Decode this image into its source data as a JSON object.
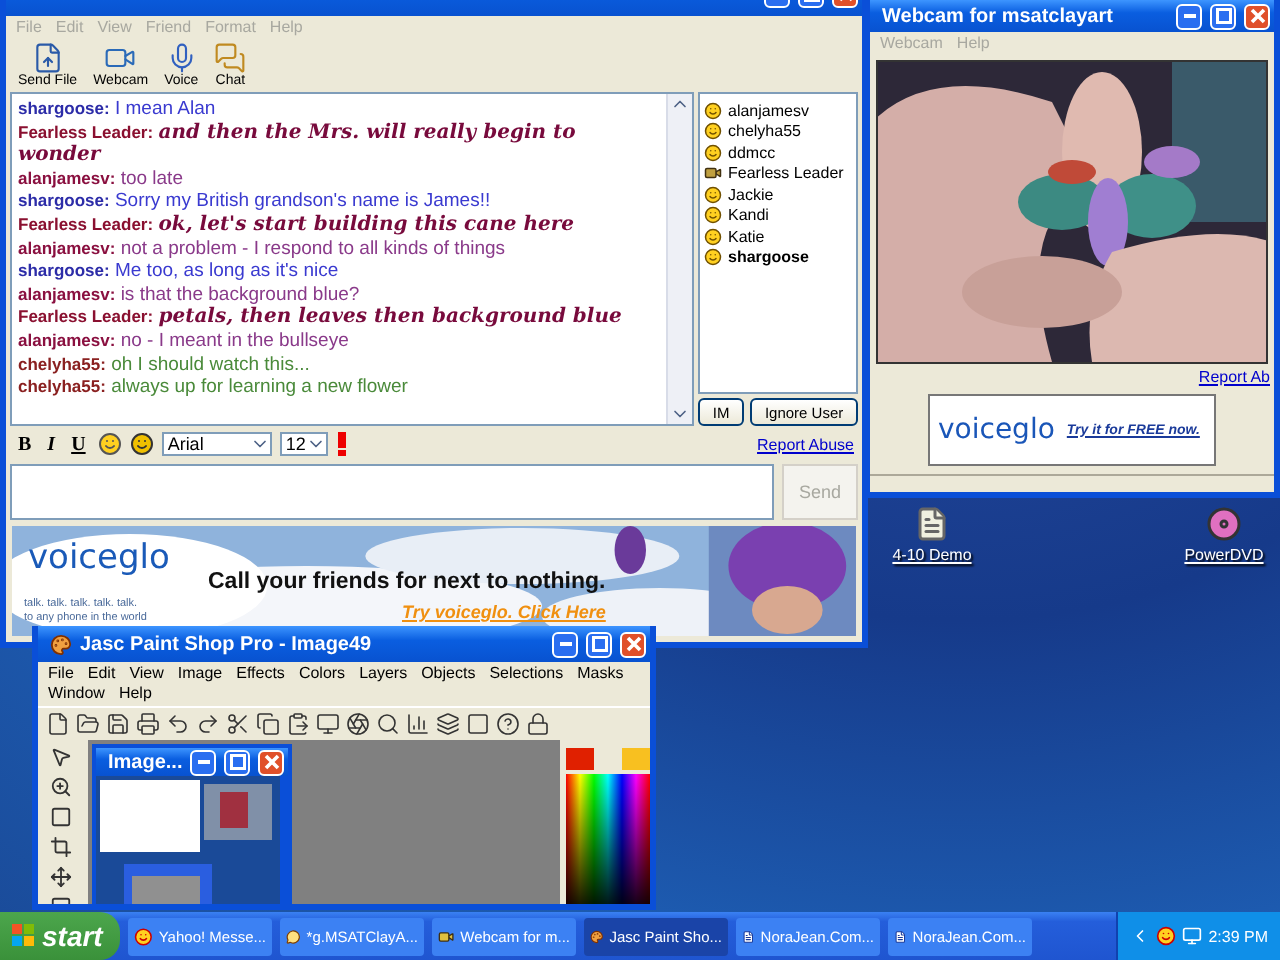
{
  "chat_window": {
    "menu": [
      "File",
      "Edit",
      "View",
      "Friend",
      "Format",
      "Help"
    ],
    "toolbar": [
      {
        "label": "Send File",
        "kind": "file"
      },
      {
        "label": "Webcam",
        "kind": "webcam"
      },
      {
        "label": "Voice",
        "kind": "voice"
      },
      {
        "label": "Chat",
        "kind": "chat"
      }
    ],
    "messages": [
      {
        "sender": {
          "name": "shargoose:",
          "color": "#2c2ca8"
        },
        "text": "I mean Alan",
        "kind": "plain",
        "color": "#3a3ad0"
      },
      {
        "sender": {
          "name": "Fearless Leader:",
          "color": "#8a1030"
        },
        "text": "and then the Mrs. will really begin to wonder",
        "kind": "script",
        "color": "#780a3c"
      },
      {
        "sender": {
          "name": "alanjamesv:",
          "color": "#8a1040"
        },
        "text": "too late",
        "kind": "plain",
        "color": "#8a3a8a"
      },
      {
        "sender": {
          "name": "shargoose:",
          "color": "#2c2ca8"
        },
        "text": "Sorry my British grandson's name is James!!",
        "kind": "plain",
        "color": "#3a3ad0"
      },
      {
        "sender": {
          "name": "Fearless Leader:",
          "color": "#8a1030"
        },
        "text": "ok, let's start building this cane here",
        "kind": "script",
        "color": "#780a3c"
      },
      {
        "sender": {
          "name": "alanjamesv:",
          "color": "#8a1040"
        },
        "text": "not a problem - I respond to all kinds of things",
        "kind": "plain",
        "color": "#8a3a8a"
      },
      {
        "sender": {
          "name": "shargoose:",
          "color": "#2c2ca8"
        },
        "text": "Me too, as long as it's nice",
        "kind": "plain",
        "color": "#3a3ad0"
      },
      {
        "sender": {
          "name": "alanjamesv:",
          "color": "#8a1040"
        },
        "text": "is that the background blue?",
        "kind": "plain",
        "color": "#8a3a8a"
      },
      {
        "sender": {
          "name": "Fearless Leader:",
          "color": "#8a1030"
        },
        "text": "petals, then leaves then background blue",
        "kind": "script",
        "color": "#780a3c"
      },
      {
        "sender": {
          "name": "alanjamesv:",
          "color": "#8a1040"
        },
        "text": "no - I meant in the bullseye",
        "kind": "plain",
        "color": "#8a3a8a"
      },
      {
        "sender": {
          "name": "chelyha55:",
          "color": "#8a2020"
        },
        "text": "oh I should watch this...",
        "kind": "plain",
        "color": "#4a8a3a"
      },
      {
        "sender": {
          "name": "chelyha55:",
          "color": "#8a2020"
        },
        "text": "always up for learning a new flower",
        "kind": "plain",
        "color": "#4a8a3a"
      }
    ],
    "users": [
      {
        "name": "alanjamesv",
        "kind": "smiley",
        "selected": false
      },
      {
        "name": "chelyha55",
        "kind": "smiley",
        "selected": false
      },
      {
        "name": "ddmcc",
        "kind": "smiley",
        "selected": false
      },
      {
        "name": "Fearless Leader",
        "kind": "webcam",
        "selected": false
      },
      {
        "name": "Jackie",
        "kind": "smiley",
        "selected": false
      },
      {
        "name": "Kandi",
        "kind": "smiley",
        "selected": false
      },
      {
        "name": "Katie",
        "kind": "smiley",
        "selected": false
      },
      {
        "name": "shargoose",
        "kind": "smiley",
        "selected": true
      }
    ],
    "user_buttons": [
      "IM",
      "Ignore User"
    ],
    "format_bar": {
      "bold": "B",
      "italic": "I",
      "underline": "U",
      "font": "Arial",
      "size": "12",
      "link": "Report Abuse"
    },
    "send_button": {
      "label": "Send",
      "disabled": true
    },
    "ad": {
      "brand": "voiceglo",
      "tagline": "talk. talk. talk. talk. talk.",
      "tagline_2": "to any phone in the world",
      "headline": "Call your friends for next to nothing.",
      "link": "Try voiceglo. Click Here"
    }
  },
  "webcam_window": {
    "title": "Webcam for msatclayart",
    "menu": [
      "Webcam",
      "Help"
    ],
    "link": "Report Ab",
    "ad": {
      "brand": "voiceglo",
      "link": "Try it for FREE now."
    }
  },
  "desktop_icons": [
    {
      "label": "4-10 Demo",
      "kind": "document"
    },
    {
      "label": "PowerDVD",
      "kind": "disc"
    }
  ],
  "paint_window": {
    "title": "Jasc Paint Shop Pro - Image49",
    "menu": [
      "File",
      "Edit",
      "View",
      "Image",
      "Effects",
      "Colors",
      "Layers",
      "Objects",
      "Selections",
      "Masks",
      "Window",
      "Help"
    ],
    "image_window": {
      "title": "Image..."
    }
  },
  "taskbar": {
    "start": "start",
    "items": [
      {
        "label": "Yahoo! Messe...",
        "kind": "messenger",
        "selected": false
      },
      {
        "label": "*g.MSATClayA...",
        "kind": "chat",
        "selected": false
      },
      {
        "label": "Webcam for m...",
        "kind": "webcam",
        "selected": false
      },
      {
        "label": "Jasc Paint Sho...",
        "kind": "paint",
        "selected": true
      },
      {
        "label": "NoraJean.Com...",
        "kind": "document",
        "selected": false
      },
      {
        "label": "NoraJean.Com...",
        "kind": "document",
        "selected": false
      }
    ],
    "clock": "2:39 PM"
  }
}
